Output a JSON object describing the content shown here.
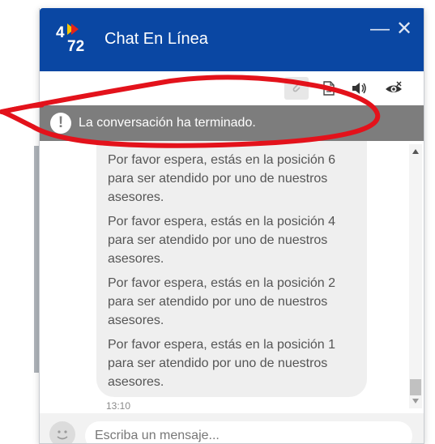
{
  "window": {
    "title": "Chat En Línea",
    "minimize_glyph": "—",
    "close_glyph": "✕"
  },
  "logo": {
    "text_4": "4",
    "text_72": "72",
    "brand": "4-72-logo"
  },
  "toolbar": {
    "icons": [
      "attach-icon",
      "document-icon",
      "sound-icon",
      "visibility-icon"
    ]
  },
  "banner": {
    "text": "La conversación ha terminado.",
    "icon_glyph": "!"
  },
  "messages": [
    "Por favor espera, estás en la posición 6 para ser atendido por uno de nuestros asesores.",
    "Por favor espera, estás en la posición 4 para ser atendido por uno de nuestros asesores.",
    "Por favor espera, estás en la posición 2 para ser atendido por uno de nuestros asesores.",
    "Por favor espera, estás en la posición 1 para ser atendido por uno de nuestros asesores."
  ],
  "timestamp": "13:10",
  "composer": {
    "placeholder": "Escriba un mensaje..."
  },
  "colors": {
    "header": "#0a47a3",
    "banner": "#7d7d7d",
    "bubble": "#efefef",
    "annotation": "#e3121b"
  }
}
